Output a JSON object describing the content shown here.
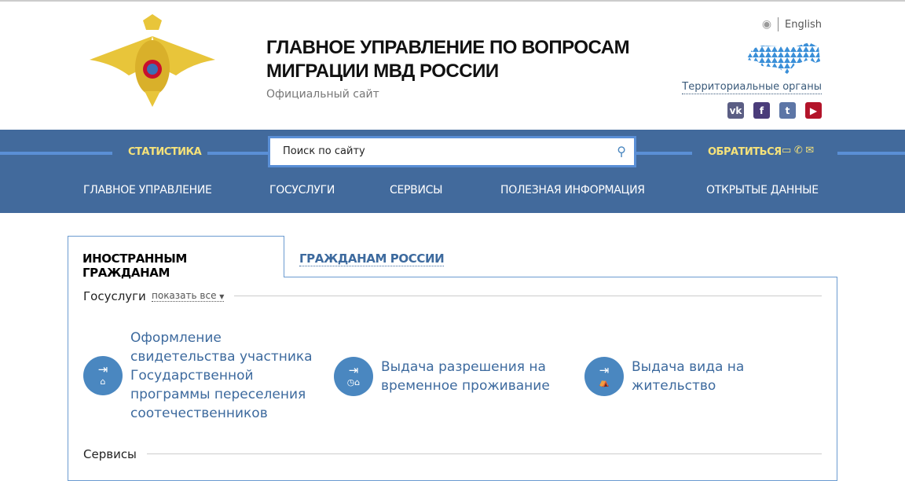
{
  "header": {
    "title_line1": "ГЛАВНОЕ УПРАВЛЕНИЕ ПО ВОПРОСАМ",
    "title_line2": "МИГРАЦИИ МВД РОССИИ",
    "subtitle": "Официальный сайт",
    "language": "English",
    "territorial": "Территориальные органы",
    "social": [
      {
        "icon": "vk-icon",
        "label": "vk",
        "color": "#5b5e84"
      },
      {
        "icon": "facebook-icon",
        "label": "f",
        "color": "#4a3c7a"
      },
      {
        "icon": "twitter-icon",
        "label": "t",
        "color": "#5d76a6"
      },
      {
        "icon": "youtube-icon",
        "label": "▶",
        "color": "#b3142a"
      }
    ]
  },
  "topbar": {
    "statistics": "СТАТИСТИКА",
    "search_placeholder": "Поиск по сайту",
    "contact": "ОБРАТИТЬСЯ"
  },
  "menu": [
    "ГЛАВНОЕ УПРАВЛЕНИЕ",
    "ГОСУСЛУГИ",
    "СЕРВИСЫ",
    "ПОЛЕЗНАЯ ИНФОРМАЦИЯ",
    "ОТКРЫТЫЕ ДАННЫЕ"
  ],
  "tabs": [
    "ИНОСТРАННЫМ ГРАЖДАНАМ",
    "ГРАЖДАНАМ РОССИИ"
  ],
  "gosuslugi": {
    "title": "Госуслуги",
    "show_all": "показать все"
  },
  "services": [
    {
      "lines": [
        "Оформление",
        "свидетельства участника",
        "Государственной",
        "программы переселения",
        "соотечественников"
      ]
    },
    {
      "lines": [
        "Выдача разрешения на",
        "временное проживание"
      ]
    },
    {
      "lines": [
        "Выдача вида на",
        "жительство"
      ]
    }
  ],
  "servisy_title": "Сервисы",
  "colors": {
    "nav": "#426a9c",
    "accent": "#f5e27a",
    "link": "#3d6a9e",
    "icon": "#4a87c0"
  }
}
